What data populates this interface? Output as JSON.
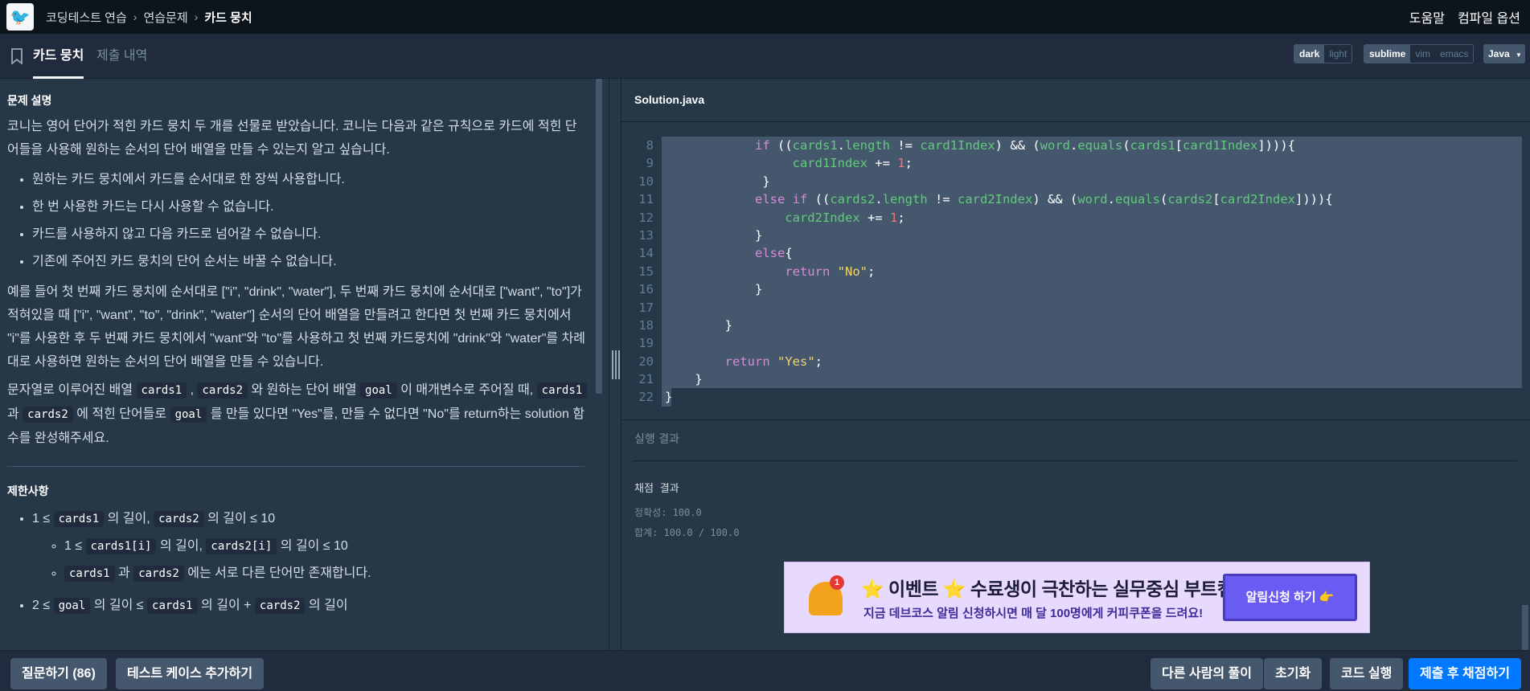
{
  "nav": {
    "breadcrumbs": [
      "코딩테스트 연습",
      "연습문제",
      "카드 뭉치"
    ],
    "help": "도움말",
    "compile_options": "컴파일 옵션"
  },
  "tabs": {
    "active": "카드 뭉치",
    "history": "제출 내역"
  },
  "editor_settings": {
    "themes": [
      "dark",
      "light"
    ],
    "keymaps": [
      "sublime",
      "vim",
      "emacs"
    ],
    "language": "Java"
  },
  "description": {
    "section_title": "문제 설명",
    "intro": "코니는 영어 단어가 적힌 카드 뭉치 두 개를 선물로 받았습니다. 코니는 다음과 같은 규칙으로 카드에 적힌 단어들을 사용해 원하는 순서의 단어 배열을 만들 수 있는지 알고 싶습니다.",
    "rules": [
      "원하는 카드 뭉치에서 카드를 순서대로 한 장씩 사용합니다.",
      "한 번 사용한 카드는 다시 사용할 수 없습니다.",
      "카드를 사용하지 않고 다음 카드로 넘어갈 수 없습니다.",
      "기존에 주어진 카드 뭉치의 단어 순서는 바꿀 수 없습니다."
    ],
    "example": "예를 들어 첫 번째 카드 뭉치에 순서대로 [\"i\", \"drink\", \"water\"], 두 번째 카드 뭉치에 순서대로 [\"want\", \"to\"]가 적혀있을 때 [\"i\", \"want\", \"to\", \"drink\", \"water\"] 순서의 단어 배열을 만들려고 한다면 첫 번째 카드 뭉치에서 \"i\"를 사용한 후 두 번째 카드 뭉치에서 \"want\"와 \"to\"를 사용하고 첫 번째 카드뭉치에 \"drink\"와 \"water\"를 차례대로 사용하면 원하는 순서의 단어 배열을 만들 수 있습니다.",
    "task": {
      "t1": "문자열로 이루어진 배열 ",
      "c1": "cards1",
      "t2": " , ",
      "c2": "cards2",
      "t3": " 와 원하는 단어 배열 ",
      "c3": "goal",
      "t4": " 이 매개변수로 주어질 때, ",
      "c4": "cards1",
      "t5": " 과 ",
      "c5": "cards2",
      "t6": " 에 적힌 단어들로 ",
      "c6": "goal",
      "t7": " 를 만들 있다면 \"Yes\"를, 만들 수 없다면 \"No\"를 return하는 solution 함수를 완성해주세요."
    },
    "constraints_title": "제한사항",
    "constraints": {
      "a_pre": "1 ≤ ",
      "a_c1": "cards1",
      "a_mid": " 의 길이, ",
      "a_c2": "cards2",
      "a_post": " 의 길이 ≤ 10",
      "b_pre": "1 ≤ ",
      "b_c1": "cards1[i]",
      "b_mid": " 의 길이, ",
      "b_c2": "cards2[i]",
      "b_post": " 의 길이 ≤ 10",
      "c_c1": "cards1",
      "c_mid": " 과 ",
      "c_c2": "cards2",
      "c_post": " 에는 서로 다른 단어만 존재합니다.",
      "d_pre": "2 ≤ ",
      "d_c1": "goal",
      "d_mid1": " 의 길이 ≤ ",
      "d_c2": "cards1",
      "d_mid2": " 의 길이 + ",
      "d_c3": "cards2",
      "d_post": " 의 길이"
    }
  },
  "editor": {
    "filename": "Solution.java",
    "line_numbers": [
      "8",
      "9",
      "10",
      "11",
      "12",
      "13",
      "14",
      "15",
      "16",
      "17",
      "18",
      "19",
      "20",
      "21",
      "22"
    ]
  },
  "results": {
    "run_title": "실행 결과",
    "grade_title": "채점 결과",
    "accuracy": "정확성: 100.0",
    "total": "합계: 100.0 / 100.0"
  },
  "banner": {
    "badge": "1",
    "title": "⭐ 이벤트 ⭐ 수료생이 극찬하는 실무중심 부트캠프",
    "subtitle": "지금 데브코스 알림 신청하시면 매 달 100명에게 커피쿠폰을 드려요!",
    "button": "알림신청 하기 👉"
  },
  "bottom": {
    "ask": "질문하기 (86)",
    "add_test": "테스트 케이스 추가하기",
    "others": "다른 사람의 풀이",
    "reset": "초기화",
    "run": "코드 실행",
    "submit": "제출 후 채점하기"
  }
}
